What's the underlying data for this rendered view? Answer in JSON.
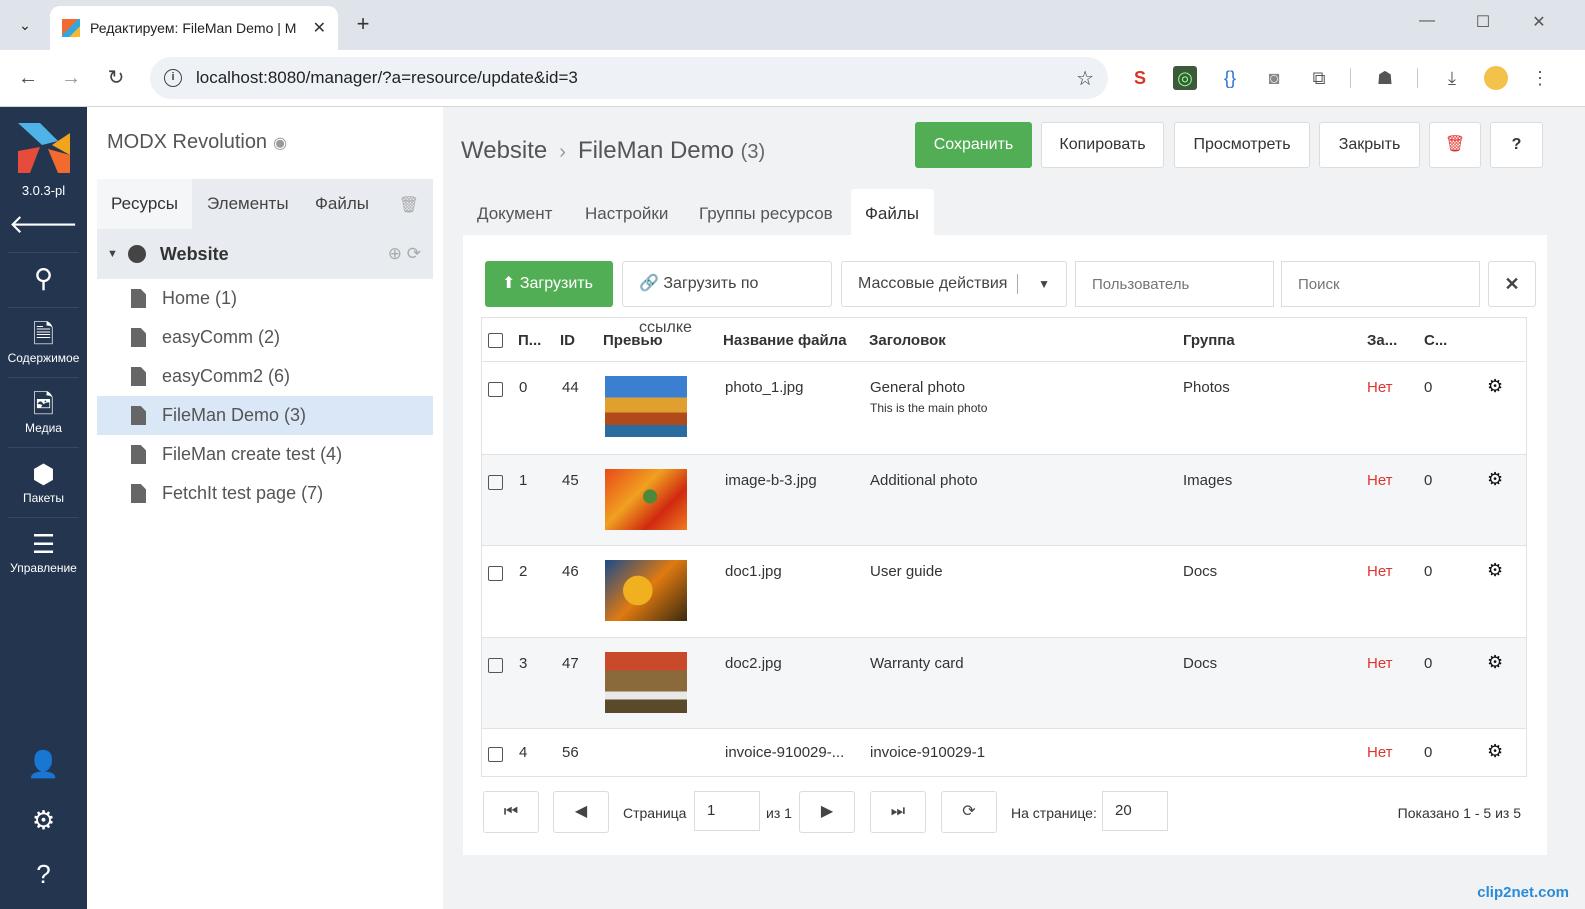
{
  "browser": {
    "tab_title": "Редактируем: FileMan Demo | M",
    "url": "localhost:8080/manager/?a=resource/update&id=3"
  },
  "rail": {
    "version": "3.0.3-pl",
    "items": [
      {
        "label": "Содержимое"
      },
      {
        "label": "Медиа"
      },
      {
        "label": "Пакеты"
      },
      {
        "label": "Управление"
      }
    ]
  },
  "tree": {
    "site_name": "MODX Revolution",
    "tabs": [
      "Ресурсы",
      "Элементы",
      "Файлы"
    ],
    "root": "Website",
    "items": [
      "Home (1)",
      "easyComm (2)",
      "easyComm2 (6)",
      "FileMan Demo (3)",
      "FileMan create test (4)",
      "FetchIt test page (7)"
    ]
  },
  "main": {
    "breadcrumb_root": "Website",
    "breadcrumb_page": "FileMan Demo",
    "breadcrumb_count": "(3)",
    "actions": {
      "save": "Сохранить",
      "copy": "Копировать",
      "view": "Просмотреть",
      "close": "Закрыть"
    },
    "tabs": [
      "Документ",
      "Настройки",
      "Группы ресурсов",
      "Файлы"
    ],
    "files": {
      "upload": "Загрузить",
      "upload_url": "Загрузить по ссылке",
      "bulk": "Массовые действия",
      "user_placeholder": "Пользователь",
      "search_placeholder": "Поиск",
      "columns": [
        "П...",
        "ID",
        "Превью",
        "Название файла",
        "Заголовок",
        "Группа",
        "За...",
        "С..."
      ],
      "rows": [
        {
          "pos": "0",
          "id": "44",
          "file": "photo_1.jpg",
          "title": "General photo",
          "desc": "This is the main photo",
          "group": "Photos",
          "priv": "Нет",
          "count": "0"
        },
        {
          "pos": "1",
          "id": "45",
          "file": "image-b-3.jpg",
          "title": "Additional photo",
          "desc": "",
          "group": "Images",
          "priv": "Нет",
          "count": "0"
        },
        {
          "pos": "2",
          "id": "46",
          "file": "doc1.jpg",
          "title": "User guide",
          "desc": "",
          "group": "Docs",
          "priv": "Нет",
          "count": "0"
        },
        {
          "pos": "3",
          "id": "47",
          "file": "doc2.jpg",
          "title": "Warranty card",
          "desc": "",
          "group": "Docs",
          "priv": "Нет",
          "count": "0"
        },
        {
          "pos": "4",
          "id": "56",
          "file": "invoice-910029-...",
          "title": "invoice-910029-1",
          "desc": "",
          "group": "",
          "priv": "Нет",
          "count": "0"
        }
      ],
      "pager": {
        "page_label": "Страница",
        "page": "1",
        "of": "из 1",
        "per_page_label": "На странице:",
        "per_page": "20",
        "shown": "Показано 1 - 5 из 5"
      }
    }
  },
  "watermark": "clip2net.com",
  "colors": {
    "accent_green": "#52ae55",
    "rail": "#24364f",
    "no_red": "#e0342e"
  }
}
